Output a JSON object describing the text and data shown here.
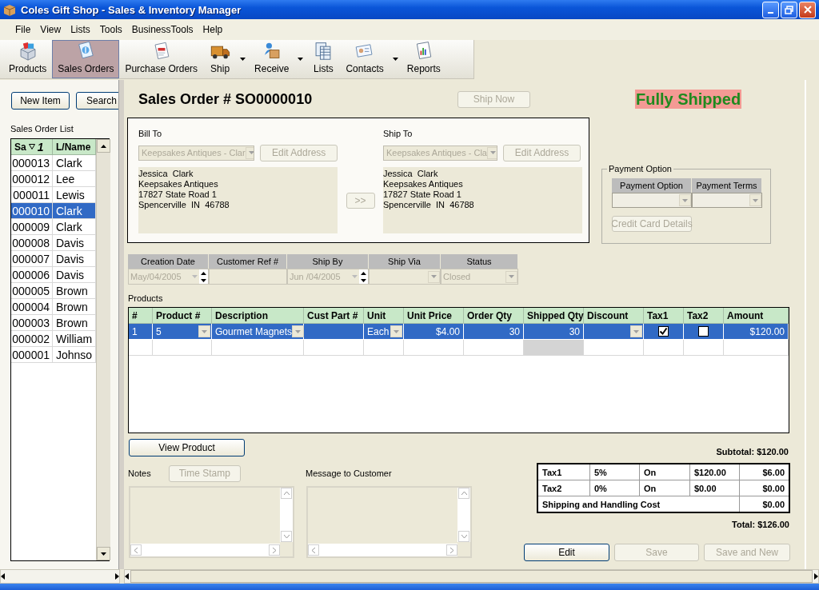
{
  "window": {
    "title": "Coles Gift Shop - Sales & Inventory Manager"
  },
  "menu": [
    "File",
    "View",
    "Lists",
    "Tools",
    "BusinessTools",
    "Help"
  ],
  "toolbar": [
    {
      "label": "Products",
      "selected": false,
      "dropdown": false
    },
    {
      "label": "Sales Orders",
      "selected": true,
      "dropdown": false
    },
    {
      "label": "Purchase Orders",
      "selected": false,
      "dropdown": false
    },
    {
      "label": "Ship",
      "selected": false,
      "dropdown": true
    },
    {
      "label": "Receive",
      "selected": false,
      "dropdown": true
    },
    {
      "label": "Lists",
      "selected": false,
      "dropdown": false
    },
    {
      "label": "Contacts",
      "selected": false,
      "dropdown": true
    },
    {
      "label": "Reports",
      "selected": false,
      "dropdown": false
    }
  ],
  "sidebar": {
    "buttons": [
      "New Item",
      "Search"
    ],
    "list_title": "Sales Order List",
    "columns": [
      {
        "label": "Sa",
        "sort": "1"
      },
      {
        "label": "L/Name"
      }
    ],
    "rows": [
      {
        "number": "000013",
        "name": "Clark",
        "selected": false
      },
      {
        "number": "000012",
        "name": "Lee",
        "selected": false
      },
      {
        "number": "000011",
        "name": "Lewis",
        "selected": false
      },
      {
        "number": "000010",
        "name": "Clark",
        "selected": true
      },
      {
        "number": "000009",
        "name": "Clark",
        "selected": false
      },
      {
        "number": "000008",
        "name": "Davis",
        "selected": false
      },
      {
        "number": "000007",
        "name": "Davis",
        "selected": false
      },
      {
        "number": "000006",
        "name": "Davis",
        "selected": false
      },
      {
        "number": "000005",
        "name": "Brown",
        "selected": false
      },
      {
        "number": "000004",
        "name": "Brown",
        "selected": false
      },
      {
        "number": "000003",
        "name": "Brown",
        "selected": false
      },
      {
        "number": "000002",
        "name": "William",
        "selected": false
      },
      {
        "number": "000001",
        "name": "Johnso",
        "selected": false
      }
    ]
  },
  "order": {
    "title": "Sales Order # SO0000010",
    "ship_now": {
      "label": "Ship Now",
      "disabled": true
    },
    "status_badge": "Fully Shipped",
    "bill_to": {
      "label": "Bill To",
      "customer": "Keepsakes Antiques - Clar",
      "edit": {
        "label": "Edit Address",
        "disabled": true
      },
      "address": [
        "Jessica  Clark",
        "Keepsakes Antiques",
        "17827 State Road 1",
        "Spencerville  IN  46788"
      ]
    },
    "copy_button": {
      "label": ">>",
      "disabled": true
    },
    "ship_to": {
      "label": "Ship To",
      "customer": "Keepsakes Antiques - Cla",
      "edit": {
        "label": "Edit Address",
        "disabled": true
      },
      "address": [
        "Jessica  Clark",
        "Keepsakes Antiques",
        "17827 State Road 1",
        "Spencerville  IN  46788"
      ]
    },
    "payment": {
      "title": "Payment Option",
      "columns": [
        "Payment Option",
        "Payment Terms"
      ],
      "credit_card": {
        "label": "Credit Card Details",
        "disabled": true
      }
    }
  },
  "details": [
    {
      "label": "Creation Date",
      "kind": "date",
      "value": "May/04/2005"
    },
    {
      "label": "Customer Ref #",
      "kind": "text"
    },
    {
      "label": "Ship By",
      "kind": "date",
      "value": "Jun /04/2005"
    },
    {
      "label": "Ship Via",
      "kind": "combo"
    },
    {
      "label": "Status",
      "kind": "combo",
      "value": "Closed"
    }
  ],
  "products": {
    "title": "Products",
    "columns": [
      "#",
      "Product #",
      "Description",
      "Cust Part #",
      "Unit",
      "Unit Price",
      "Order Qty",
      "Shipped Qty",
      "Discount",
      "Tax1",
      "Tax2",
      "Amount"
    ],
    "rows": [
      {
        "number": "1",
        "product": "5",
        "description": "Gourmet Magnets",
        "unit": "Each",
        "unit_price": "$4.00",
        "order_qty": "30",
        "shipped_qty": "30",
        "tax1": true,
        "tax2": false,
        "amount": "$120.00",
        "selected": true
      }
    ]
  },
  "view_product": {
    "label": "View Product",
    "disabled": false
  },
  "subtotal": "Subtotal: $120.00",
  "notes": {
    "label": "Notes",
    "time_stamp": {
      "label": "Time Stamp",
      "disabled": true
    }
  },
  "message": {
    "label": "Message to Customer"
  },
  "totals": {
    "taxes": [
      {
        "name": "Tax1",
        "rate": "5%",
        "state": "On",
        "base": "$120.00",
        "amount": "$6.00"
      },
      {
        "name": "Tax2",
        "rate": "0%",
        "state": "On",
        "base": "$0.00",
        "amount": "$0.00"
      }
    ],
    "shipping": {
      "label": "Shipping and Handling Cost",
      "amount": "$0.00"
    },
    "total": "Total: $126.00"
  },
  "actions": [
    {
      "label": "Edit",
      "disabled": false
    },
    {
      "label": "Save",
      "disabled": true
    },
    {
      "label": "Save and New",
      "disabled": true
    }
  ]
}
